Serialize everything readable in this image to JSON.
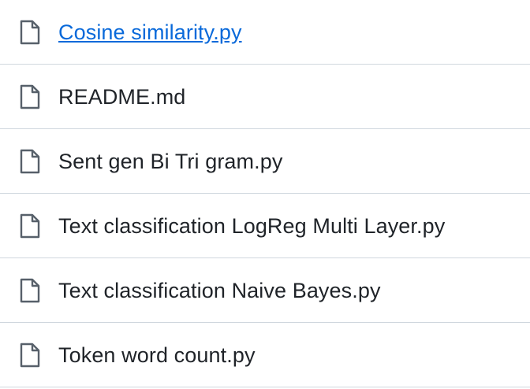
{
  "files": [
    {
      "name": "Cosine similarity.py",
      "icon": "file-icon"
    },
    {
      "name": "README.md",
      "icon": "file-icon"
    },
    {
      "name": "Sent gen Bi Tri gram.py",
      "icon": "file-icon"
    },
    {
      "name": "Text classification LogReg Multi Layer.py",
      "icon": "file-icon"
    },
    {
      "name": "Text classification Naive Bayes.py",
      "icon": "file-icon"
    },
    {
      "name": "Token word count.py",
      "icon": "file-icon"
    }
  ],
  "colors": {
    "text": "#1f2328",
    "icon": "#57606a",
    "divider": "#d0d7de"
  }
}
